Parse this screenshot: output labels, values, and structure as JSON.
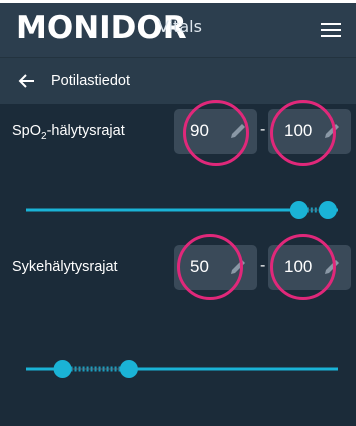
{
  "header": {
    "brand": "MONIDOR",
    "brand_sub": "Vitals",
    "menu_icon": "hamburger-menu-icon"
  },
  "subheader": {
    "back_icon": "arrow-left-icon",
    "title": "Potilastiedot"
  },
  "spo2": {
    "label_prefix": "SpO",
    "label_sub": "2",
    "label_suffix": "-hälytysrajat",
    "low": "90",
    "high": "100",
    "separator": "-",
    "slider_min": 0,
    "slider_max": 100,
    "slider_low": 90,
    "slider_high": 100
  },
  "pulse": {
    "label": "Sykehälytysrajat",
    "low": "50",
    "high": "100",
    "separator": "-",
    "slider_min": 30,
    "slider_max": 250,
    "slider_low": 50,
    "slider_high": 100
  },
  "colors": {
    "accent": "#1ab3d6",
    "highlight": "#e0287a",
    "background": "#1b2b39",
    "header": "#2c3e4e"
  },
  "icons": {
    "edit": "pencil-icon"
  }
}
